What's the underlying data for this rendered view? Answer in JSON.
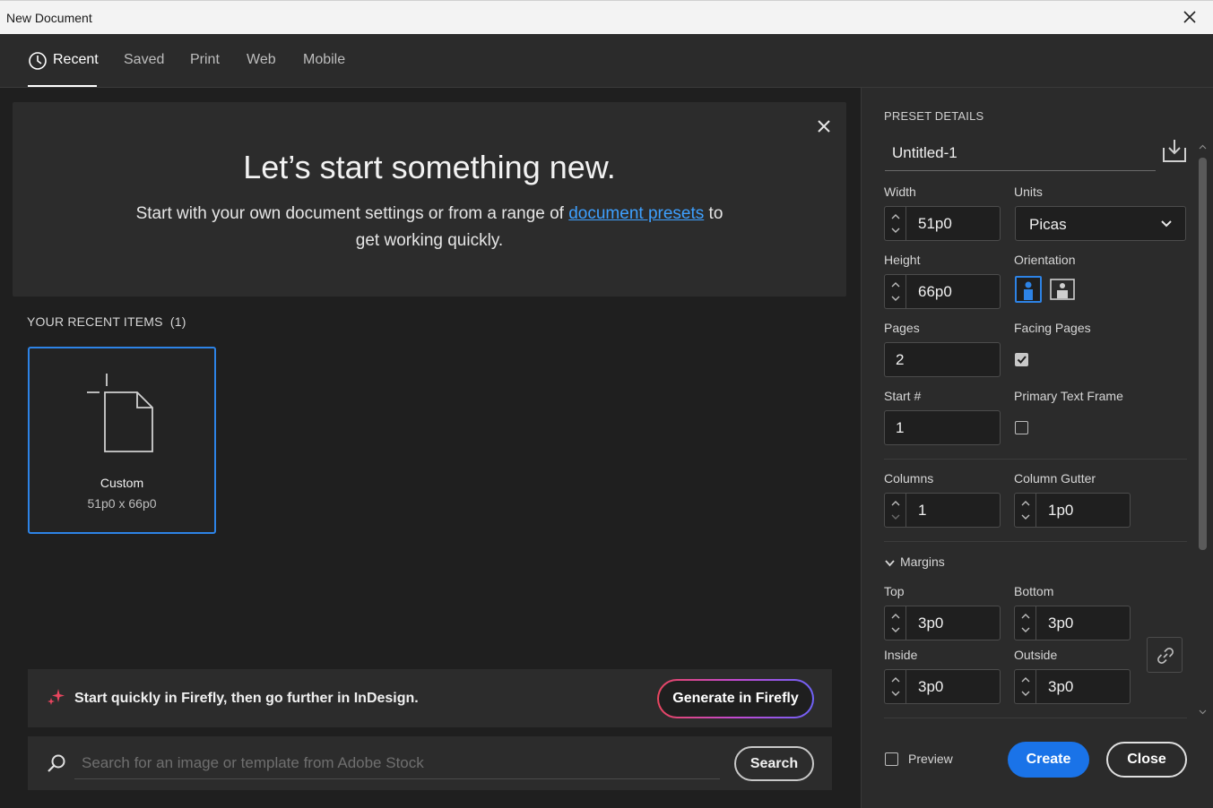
{
  "window": {
    "title": "New Document"
  },
  "tabs": [
    {
      "label": "Recent"
    },
    {
      "label": "Saved"
    },
    {
      "label": "Print"
    },
    {
      "label": "Web"
    },
    {
      "label": "Mobile"
    }
  ],
  "hero": {
    "title": "Let’s start something new.",
    "subtitle_before": "Start with your own document settings or from a range of ",
    "subtitle_link": "document presets",
    "subtitle_after": " to get working quickly."
  },
  "recent": {
    "heading": "YOUR RECENT ITEMS",
    "count": "(1)",
    "items": [
      {
        "name": "Custom",
        "dims": "51p0 x 66p0"
      }
    ]
  },
  "firefly": {
    "text": "Start quickly in Firefly, then go further in InDesign.",
    "button": "Generate in Firefly"
  },
  "stock_search": {
    "placeholder": "Search for an image or template from Adobe Stock",
    "button": "Search"
  },
  "preset": {
    "heading": "PRESET DETAILS",
    "name": "Untitled-1",
    "width_label": "Width",
    "width": "51p0",
    "units_label": "Units",
    "units": "Picas",
    "height_label": "Height",
    "height": "66p0",
    "orientation_label": "Orientation",
    "orientation": "portrait",
    "pages_label": "Pages",
    "pages": "2",
    "facing_label": "Facing Pages",
    "facing_pages": true,
    "start_label": "Start #",
    "start": "1",
    "primary_label": "Primary Text Frame",
    "primary_text_frame": false,
    "columns_label": "Columns",
    "columns": "1",
    "gutter_label": "Column Gutter",
    "gutter": "1p0",
    "margins_label": "Margins",
    "top_label": "Top",
    "top": "3p0",
    "bottom_label": "Bottom",
    "bottom": "3p0",
    "inside_label": "Inside",
    "inside": "3p0",
    "outside_label": "Outside",
    "outside": "3p0"
  },
  "footer": {
    "preview_label": "Preview",
    "create": "Create",
    "close": "Close"
  },
  "colors": {
    "accent": "#1a73e8",
    "selection": "#2d83e6",
    "link": "#3ea0ff"
  }
}
